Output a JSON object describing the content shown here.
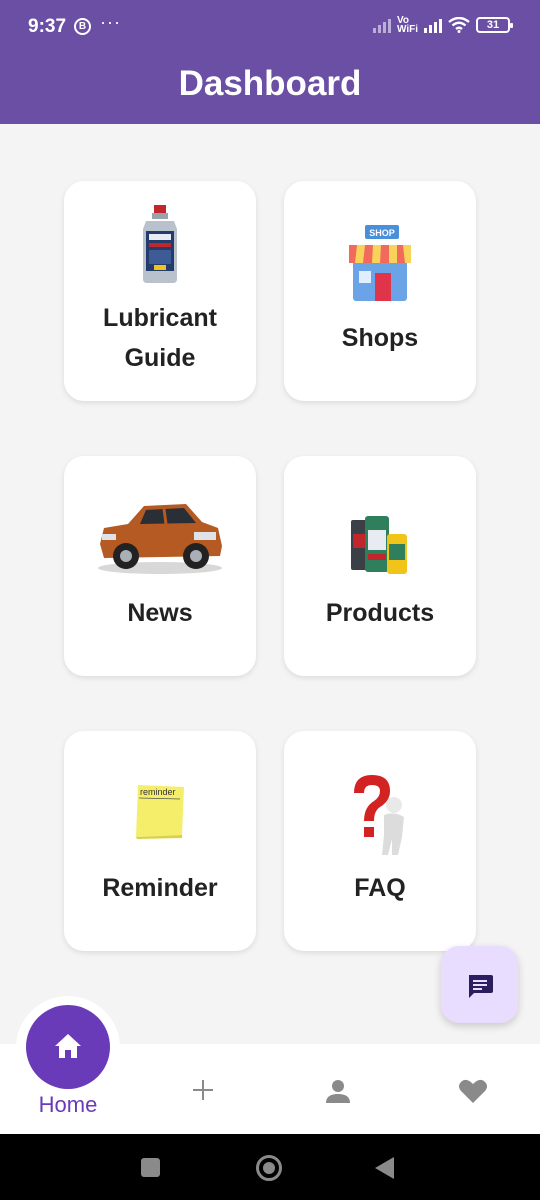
{
  "status_bar": {
    "time": "9:37",
    "b_badge": "B",
    "dots": "···",
    "network": "Vo\nWiFi",
    "battery": "31"
  },
  "app_bar": {
    "title": "Dashboard"
  },
  "cards": [
    {
      "label_line1": "Lubricant",
      "label_line2": "Guide",
      "icon": "oil-bottle-icon"
    },
    {
      "label": "Shops",
      "icon": "shop-icon"
    },
    {
      "label": "News",
      "icon": "car-icon"
    },
    {
      "label": "Products",
      "icon": "products-icon"
    },
    {
      "label": "Reminder",
      "icon": "sticky-note-icon",
      "note_text": "reminder"
    },
    {
      "label": "FAQ",
      "icon": "question-icon"
    }
  ],
  "fab": {
    "icon": "chat-icon"
  },
  "bottom_nav": {
    "home_label": "Home",
    "items": [
      "home-icon",
      "add-icon",
      "person-icon",
      "heart-icon"
    ]
  },
  "colors": {
    "primary": "#6a4fa5",
    "home_accent": "#6a3bb8",
    "fab_bg": "#e9ddff",
    "background": "#f4f4f4"
  }
}
